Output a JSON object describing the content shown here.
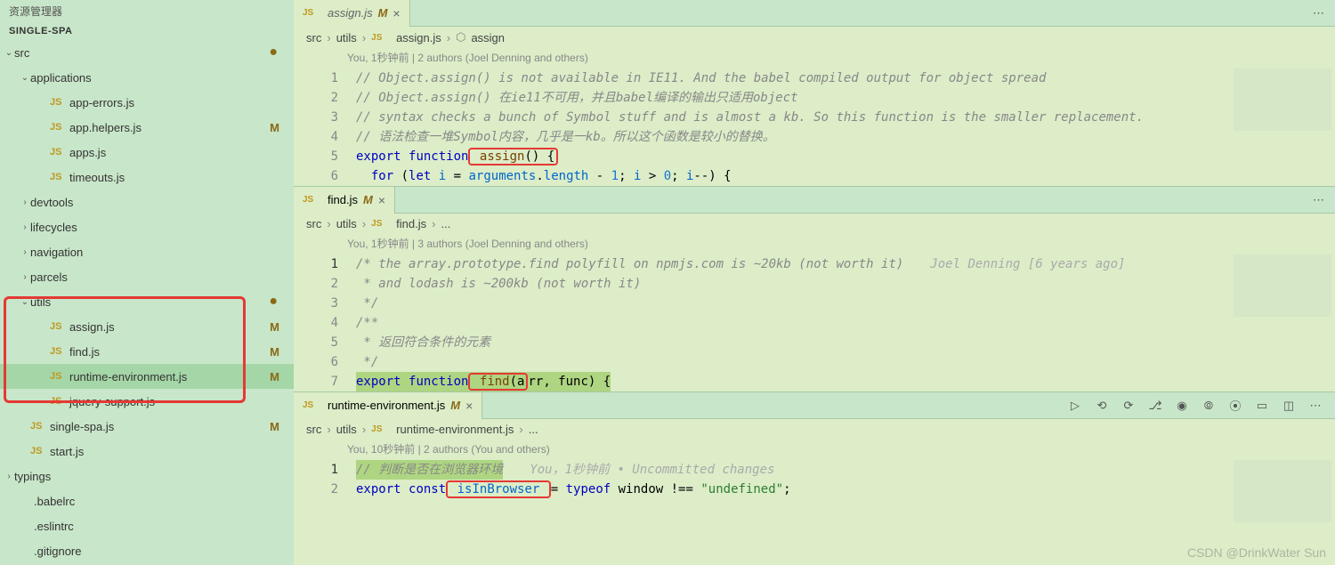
{
  "sidebar": {
    "title": "资源管理器",
    "section": "SINGLE-SPA",
    "items": [
      {
        "type": "folder",
        "label": "src",
        "indent": 0,
        "expanded": true,
        "dot": true
      },
      {
        "type": "folder",
        "label": "applications",
        "indent": 1,
        "expanded": true
      },
      {
        "type": "file",
        "label": "app-errors.js",
        "indent": 2,
        "icon": "js"
      },
      {
        "type": "file",
        "label": "app.helpers.js",
        "indent": 2,
        "icon": "js",
        "modified": true
      },
      {
        "type": "file",
        "label": "apps.js",
        "indent": 2,
        "icon": "js"
      },
      {
        "type": "file",
        "label": "timeouts.js",
        "indent": 2,
        "icon": "js"
      },
      {
        "type": "folder",
        "label": "devtools",
        "indent": 1,
        "expanded": false
      },
      {
        "type": "folder",
        "label": "lifecycles",
        "indent": 1,
        "expanded": false
      },
      {
        "type": "folder",
        "label": "navigation",
        "indent": 1,
        "expanded": false
      },
      {
        "type": "folder",
        "label": "parcels",
        "indent": 1,
        "expanded": false
      },
      {
        "type": "folder",
        "label": "utils",
        "indent": 1,
        "expanded": true,
        "dot": true
      },
      {
        "type": "file",
        "label": "assign.js",
        "indent": 2,
        "icon": "js",
        "modified": true
      },
      {
        "type": "file",
        "label": "find.js",
        "indent": 2,
        "icon": "js",
        "modified": true
      },
      {
        "type": "file",
        "label": "runtime-environment.js",
        "indent": 2,
        "icon": "js",
        "modified": true,
        "selected": true
      },
      {
        "type": "file",
        "label": "jquery-support.js",
        "indent": 2,
        "icon": "js"
      },
      {
        "type": "file",
        "label": "single-spa.js",
        "indent": 1,
        "icon": "js",
        "modified": true
      },
      {
        "type": "file",
        "label": "start.js",
        "indent": 1,
        "icon": "js"
      },
      {
        "type": "folder",
        "label": "typings",
        "indent": 0,
        "expanded": false
      },
      {
        "type": "file",
        "label": ".babelrc",
        "indent": 0
      },
      {
        "type": "file",
        "label": ".eslintrc",
        "indent": 0
      },
      {
        "type": "file",
        "label": ".gitignore",
        "indent": 0
      }
    ]
  },
  "editors": [
    {
      "tab": {
        "name": "assign.js",
        "modified": true,
        "closable": true
      },
      "breadcrumb": [
        "src",
        "utils",
        "assign.js",
        "assign"
      ],
      "breadcrumb_icons": [
        "",
        "",
        "js",
        "symbol"
      ],
      "blame": "You, 1秒钟前 | 2 authors (Joel Denning and others)",
      "lines": [
        {
          "n": 1,
          "bar": "green",
          "html": "<span class='cmt'>// Object.assign() is not available in IE11. And the babel compiled output for object spread</span>"
        },
        {
          "n": 2,
          "bar": "green",
          "html": "<span class='cmt'>// Object.assign() 在ie11不可用，并且babel编译的输出只适用object</span>"
        },
        {
          "n": 3,
          "bar": "none",
          "html": "<span class='cmt'>// syntax checks a bunch of Symbol stuff and is almost a kb. So this function is the smaller replacement.</span>"
        },
        {
          "n": 4,
          "bar": "green",
          "html": "<span class='cmt'>// 语法检查一堆Symbol内容，几乎是一kb。所以这个函数是较小的替换。</span>"
        },
        {
          "n": 5,
          "bar": "none",
          "html": "<span class='kw'>export</span> <span class='kw'>function</span><span class='inline-hl'> <span class='fn'>assign</span>() {</span>"
        },
        {
          "n": 6,
          "bar": "none",
          "html": "  <span class='kw'>for</span> (<span class='kw'>let</span> <span class='var'>i</span> = <span class='var'>arguments</span>.<span class='var'>length</span> - <span class='num'>1</span>; <span class='var'>i</span> &gt; <span class='num'>0</span>; <span class='var'>i</span>--) {"
        }
      ]
    },
    {
      "tab": {
        "name": "find.js",
        "modified": true,
        "closable": true
      },
      "breadcrumb": [
        "src",
        "utils",
        "find.js",
        "..."
      ],
      "breadcrumb_icons": [
        "",
        "",
        "js",
        ""
      ],
      "blame": "You, 1秒钟前 | 3 authors (Joel Denning and others)",
      "lines": [
        {
          "n": 1,
          "bar": "none",
          "active": true,
          "html": "<span class='cmt'>/* the array.prototype.find polyfill on npmjs.com is ~20kb (not worth it)</span>",
          "trail": "Joel Denning [6 years ago]"
        },
        {
          "n": 2,
          "bar": "none",
          "html": "<span class='cmt'> * and lodash is ~200kb (not worth it)</span>"
        },
        {
          "n": 3,
          "bar": "none",
          "html": "<span class='cmt'> */</span>"
        },
        {
          "n": 4,
          "bar": "hatch",
          "html": "<span class='cmt'>/**</span>"
        },
        {
          "n": 5,
          "bar": "hatch",
          "html": "<span class='cmt'> * 返回符合条件的元素</span>"
        },
        {
          "n": 6,
          "bar": "hatch",
          "html": "<span class='cmt'> */</span>"
        },
        {
          "n": 7,
          "bar": "none",
          "html": "<span class='kw'>export</span> <span class='kw'>function</span><span class='inline-hl'> <span class='fn'>find</span>(a</span>rr, func) {",
          "sel": true
        }
      ]
    },
    {
      "tab": {
        "name": "runtime-environment.js",
        "modified": true,
        "closable": true
      },
      "actions": [
        "play",
        "history",
        "loop",
        "branch",
        "radio",
        "nav-left",
        "nav-right",
        "tablet",
        "split",
        "more"
      ],
      "breadcrumb": [
        "src",
        "utils",
        "runtime-environment.js",
        "..."
      ],
      "breadcrumb_icons": [
        "",
        "",
        "js",
        ""
      ],
      "blame": "You, 10秒钟前 | 2 authors (You and others)",
      "lines": [
        {
          "n": 1,
          "bar": "green",
          "active": true,
          "html": "<span class='cmt'>// 判断是否在浏览器环境</span>",
          "trail": "You，1秒钟前 • Uncommitted changes",
          "sel": true
        },
        {
          "n": 2,
          "bar": "none",
          "html": "<span class='kw'>export</span> <span class='kw'>const</span><span class='inline-hl'> <span class='var'>isInBrowser</span> </span>= <span class='kw'>typeof</span> window !== <span class='str'>\"undefined\"</span>;"
        }
      ]
    }
  ],
  "watermark": "CSDN @DrinkWater Sun"
}
